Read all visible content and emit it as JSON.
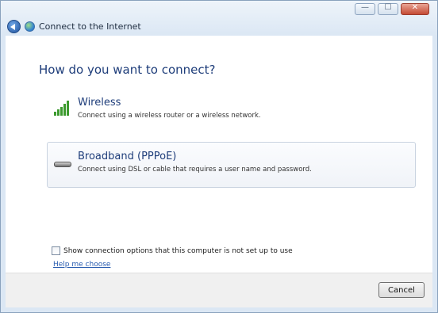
{
  "window": {
    "title": "Connect to the Internet",
    "controls": {
      "minimize": "—",
      "maximize": "☐",
      "close": "✕"
    }
  },
  "heading": "How do you want to connect?",
  "options": [
    {
      "title": "Wireless",
      "description": "Connect using a wireless router or a wireless network.",
      "icon": "wireless-signal-icon"
    },
    {
      "title": "Broadband (PPPoE)",
      "description": "Connect using DSL or cable that requires a user name and password.",
      "icon": "modem-icon"
    }
  ],
  "show_options_checkbox": {
    "label": "Show connection options that this computer is not set up to use",
    "checked": false
  },
  "help_link": "Help me choose",
  "footer": {
    "cancel_label": "Cancel"
  },
  "colors": {
    "heading": "#1e3d7a",
    "link": "#2a5db0",
    "signal": "#3c9a2e"
  }
}
